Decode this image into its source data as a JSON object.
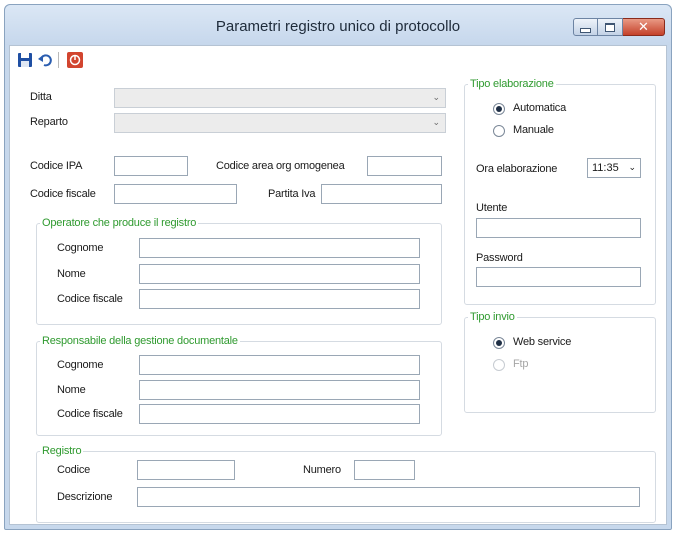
{
  "window": {
    "title": "Parametri registro unico di protocollo",
    "close_glyph": "✕"
  },
  "toolbar": {
    "save_icon": "floppy-disk-icon",
    "undo_icon": "undo-arrow-icon",
    "stop_icon": "stop-icon"
  },
  "form": {
    "ditta_label": "Ditta",
    "reparto_label": "Reparto",
    "codice_ipa_label": "Codice IPA",
    "codice_area_label": "Codice area org omogenea",
    "codice_fiscale_label": "Codice fiscale",
    "partita_iva_label": "Partita Iva",
    "dropdown_arrow": "⌄"
  },
  "operatore": {
    "caption": "Operatore che produce il registro",
    "cognome_label": "Cognome",
    "nome_label": "Nome",
    "codice_fiscale_label": "Codice fiscale"
  },
  "responsabile": {
    "caption": "Responsabile della gestione documentale",
    "cognome_label": "Cognome",
    "nome_label": "Nome",
    "codice_fiscale_label": "Codice fiscale"
  },
  "registro": {
    "caption": "Registro",
    "codice_label": "Codice",
    "numero_label": "Numero",
    "descrizione_label": "Descrizione"
  },
  "tipo_elaborazione": {
    "caption": "Tipo elaborazione",
    "automatica_label": "Automatica",
    "manuale_label": "Manuale",
    "ora_label": "Ora elaborazione",
    "ora_value": "11:35",
    "utente_label": "Utente",
    "password_label": "Password"
  },
  "tipo_invio": {
    "caption": "Tipo invio",
    "web_service_label": "Web service",
    "ftp_label": "Ftp"
  },
  "colors": {
    "group_caption": "#2f9a2f",
    "window_frame": "#c7d8ec",
    "close_button": "#c4412a"
  }
}
